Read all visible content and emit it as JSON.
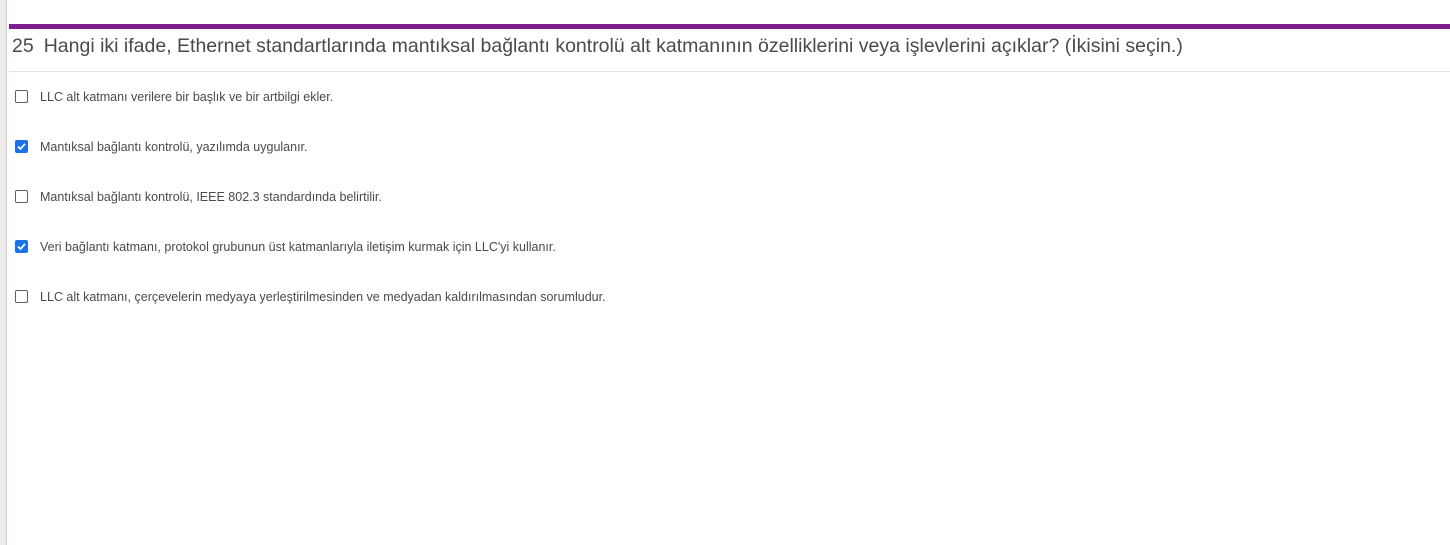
{
  "question": {
    "number": "25",
    "text": "Hangi iki ifade, Ethernet standartlarında mantıksal bağlantı kontrolü alt katmanının özelliklerini veya işlevlerini açıklar? (İkisini seçin.)"
  },
  "options": [
    {
      "label": "LLC alt katmanı verilere bir başlık ve bir artbilgi ekler.",
      "checked": false
    },
    {
      "label": "Mantıksal bağlantı kontrolü, yazılımda uygulanır.",
      "checked": true
    },
    {
      "label": "Mantıksal bağlantı kontrolü, IEEE 802.3 standardında belirtilir.",
      "checked": false
    },
    {
      "label": "Veri bağlantı katmanı, protokol grubunun üst katmanlarıyla iletişim kurmak için LLC'yi kullanır.",
      "checked": true
    },
    {
      "label": "LLC alt katmanı, çerçevelerin medyaya yerleştirilmesinden ve medyadan kaldırılmasından sorumludur.",
      "checked": false
    }
  ],
  "colors": {
    "accent": "#7b1c8f",
    "checkbox_checked": "#1a73e8",
    "text": "#4a4a4a"
  }
}
